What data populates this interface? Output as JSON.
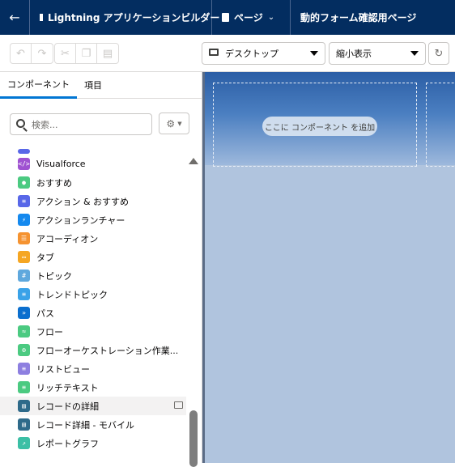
{
  "topbar": {
    "app_name": "Lightning アプリケーションビルダー",
    "page_menu": "ページ",
    "page_title": "動的フォーム確認用ページ"
  },
  "toolbar": {
    "device": "デスクトップ",
    "zoom": "縮小表示"
  },
  "left": {
    "tabs": [
      "コンポーネント",
      "項目"
    ],
    "search_placeholder": "検索..."
  },
  "components": [
    {
      "label": "Visualforce",
      "icon": "visualforce-icon",
      "color": "#9f52d1",
      "glyph": "</>"
    },
    {
      "label": "おすすめ",
      "icon": "lightbulb-icon",
      "color": "#4bca81",
      "glyph": "●"
    },
    {
      "label": "アクション & おすすめ",
      "icon": "action-list-icon",
      "color": "#5867e8",
      "glyph": "≡"
    },
    {
      "label": "アクションランチャー",
      "icon": "lightning-icon",
      "color": "#1589ee",
      "glyph": "⚡"
    },
    {
      "label": "アコーディオン",
      "icon": "accordion-icon",
      "color": "#f59331",
      "glyph": "☰"
    },
    {
      "label": "タブ",
      "icon": "tabs-icon",
      "color": "#f5a623",
      "glyph": "▭"
    },
    {
      "label": "トピック",
      "icon": "topic-icon",
      "color": "#5fa8dd",
      "glyph": "#"
    },
    {
      "label": "トレンドトピック",
      "icon": "trending-topics-icon",
      "color": "#3aa2e8",
      "glyph": "≡"
    },
    {
      "label": "パス",
      "icon": "path-icon",
      "color": "#0b6fce",
      "glyph": "»"
    },
    {
      "label": "フロー",
      "icon": "flow-icon",
      "color": "#4bca81",
      "glyph": "≈"
    },
    {
      "label": "フローオーケストレーション作業...",
      "icon": "orchestration-icon",
      "color": "#4bca81",
      "glyph": "⚙"
    },
    {
      "label": "リストビュー",
      "icon": "list-view-icon",
      "color": "#8d7fe0",
      "glyph": "≡"
    },
    {
      "label": "リッチテキスト",
      "icon": "rich-text-icon",
      "color": "#4bca81",
      "glyph": "≡"
    },
    {
      "label": "レコードの詳細",
      "icon": "record-detail-icon",
      "color": "#2e6a8a",
      "glyph": "▤"
    },
    {
      "label": "レコード詳細 - モバイル",
      "icon": "record-detail-mobile-icon",
      "color": "#2e6a8a",
      "glyph": "▤"
    },
    {
      "label": "レポートグラフ",
      "icon": "report-chart-icon",
      "color": "#3bbfa5",
      "glyph": "↗"
    }
  ],
  "canvas": {
    "add_component_label": "ここに コンポーネント を追加"
  }
}
